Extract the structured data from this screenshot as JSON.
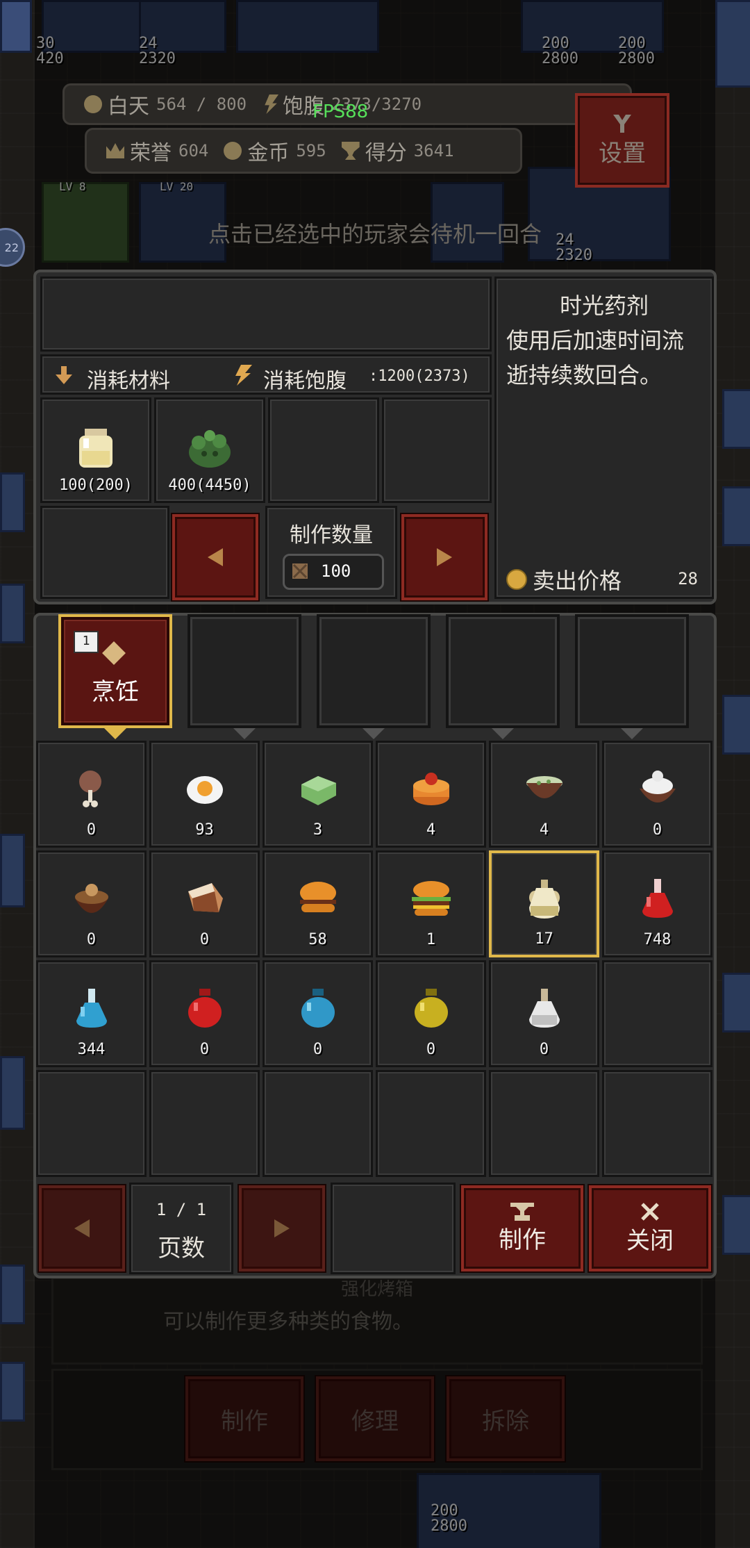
{
  "hud": {
    "day_label": "白天",
    "day_value": "564 / 800",
    "satiety_label": "饱腹",
    "satiety_value": "2373/3270",
    "honor_label": "荣誉",
    "honor_value": "604",
    "gold_label": "金币",
    "gold_value": "595",
    "score_label": "得分",
    "score_value": "3641",
    "fps": "FPS88",
    "settings_label": "设置",
    "hint": "点击已经选中的玩家会待机一回合",
    "level_badge": "22"
  },
  "background": {
    "labels": [
      {
        "top": "30",
        "bottom": "420"
      },
      {
        "top": "24",
        "bottom": "2320"
      },
      {
        "top": "200",
        "bottom": "2800"
      },
      {
        "top": "200",
        "bottom": "2800"
      },
      {
        "top": "24",
        "bottom": "2320"
      },
      {
        "top": "200",
        "bottom": "2800"
      }
    ],
    "lv_labels": [
      "LV 8",
      "LV 20"
    ],
    "building_name": "强化烤箱",
    "building_desc": "可以制作更多种类的食物。",
    "building_buttons": [
      "制作",
      "修理",
      "拆除"
    ]
  },
  "craft": {
    "consume_material_label": "消耗材料",
    "consume_satiety_label": "消耗饱腹",
    "consume_satiety_value": ":1200(2373)",
    "materials": [
      {
        "icon": "jar-icon",
        "amount": "100(200)"
      },
      {
        "icon": "green-herb-icon",
        "amount": "400(4450)"
      }
    ],
    "quantity_label": "制作数量",
    "quantity_value": "100",
    "item_name": "时光药剂",
    "item_desc_line1": "使用后加速时间流",
    "item_desc_line2": "逝持续数回合。",
    "sell_price_label": "卖出价格",
    "sell_price_value": "28"
  },
  "categories": {
    "active": {
      "badge": "1",
      "label": "烹饪"
    }
  },
  "items": [
    {
      "icon": "drumstick-icon",
      "count": "0"
    },
    {
      "icon": "fried-egg-icon",
      "count": "93"
    },
    {
      "icon": "green-soap-icon",
      "count": "3"
    },
    {
      "icon": "cake-icon",
      "count": "4"
    },
    {
      "icon": "soup-bowl-icon",
      "count": "4"
    },
    {
      "icon": "cream-bowl-icon",
      "count": "0"
    },
    {
      "icon": "pudding-icon",
      "count": "0"
    },
    {
      "icon": "bread-icon",
      "count": "0"
    },
    {
      "icon": "burger-icon",
      "count": "58"
    },
    {
      "icon": "deluxe-burger-icon",
      "count": "1"
    },
    {
      "icon": "time-potion-icon",
      "count": "17"
    },
    {
      "icon": "red-potion-icon",
      "count": "748"
    },
    {
      "icon": "blue-potion-icon",
      "count": "344"
    },
    {
      "icon": "red-jar-icon",
      "count": "0"
    },
    {
      "icon": "blue-jar-icon",
      "count": "0"
    },
    {
      "icon": "yellow-jar-icon",
      "count": "0"
    },
    {
      "icon": "white-potion-icon",
      "count": "0"
    }
  ],
  "selected_index": 10,
  "pager": {
    "value": "1 / 1",
    "label": "页数"
  },
  "actions": {
    "craft_label": "制作",
    "close_label": "关闭"
  }
}
